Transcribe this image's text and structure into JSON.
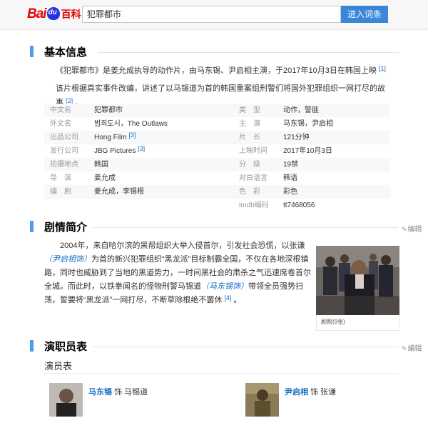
{
  "header": {
    "logo_bai": "Bai",
    "logo_baike": "百科",
    "search_value": "犯罪都市",
    "search_button": "进入词条"
  },
  "basic_info": {
    "title": "基本信息",
    "intro1_prefix": "《犯罪都市》是姜允成执导的动作片，由马东锡、尹启相主演，于2017年10月3日在韩国上映",
    "intro1_ref": "[1]",
    "intro2_prefix": "该片根据真实事件改编，讲述了以马锡道为首的韩国重案组刑警们将国外犯罪组织一网打尽的故事",
    "intro2_ref": "[2]",
    "intro2_suffix": "。",
    "left": [
      {
        "key": "中文名",
        "value": "犯罪都市"
      },
      {
        "key": "外文名",
        "value": "범죄도시，The Outlaws"
      },
      {
        "key": "出品公司",
        "value": "Hong Film",
        "ref": "[3]"
      },
      {
        "key": "发行公司",
        "value": "JBG Pictures",
        "ref": "[3]"
      },
      {
        "key": "拍摄地点",
        "value": "韩国"
      },
      {
        "key": "导　演",
        "value": "姜允成"
      },
      {
        "key": "编　剧",
        "value": "姜允成，李锡根"
      }
    ],
    "right": [
      {
        "key": "类　型",
        "value": "动作，警匪"
      },
      {
        "key": "主　演",
        "value": "马东锡，尹启相"
      },
      {
        "key": "片　长",
        "value": "121分钟"
      },
      {
        "key": "上映时间",
        "value": "2017年10月3日"
      },
      {
        "key": "分　级",
        "value": "19禁"
      },
      {
        "key": "对白语言",
        "value": "韩语"
      },
      {
        "key": "色　彩",
        "value": "彩色"
      },
      {
        "key": "imdb编码",
        "value": "tt7468056"
      }
    ]
  },
  "plot": {
    "title": "剧情简介",
    "edit": "编辑",
    "p1": "2004年，来自哈尔滨的黑帮组织大举入侵首尔，引发社会恐慌，以张谦",
    "name1": "（尹启相饰）",
    "p2": "为首的新兴犯罪组织“黑龙派”目标制霸全国，不仅在各地深根镇路，同时也威胁到了当地的黑道势力，一时间黑社会的肃杀之气迅速席卷首尔全城。而此时，以铁拳闻名的怪物刑警马锡道",
    "name2": "（马东锡饰）",
    "p3": "带领全员强势扫荡，誓要将“黑龙派”一网打尽，不断草除根绝不罢休",
    "ref": "[4]",
    "p4": "。",
    "image_caption": "剧照(9张)"
  },
  "cast": {
    "title": "演职员表",
    "edit": "编辑",
    "subtitle": "演员表",
    "actors": [
      {
        "name": "马东锡",
        "role": "饰 马锡道"
      },
      {
        "name": "尹启相",
        "role": "饰 张谦"
      }
    ]
  }
}
